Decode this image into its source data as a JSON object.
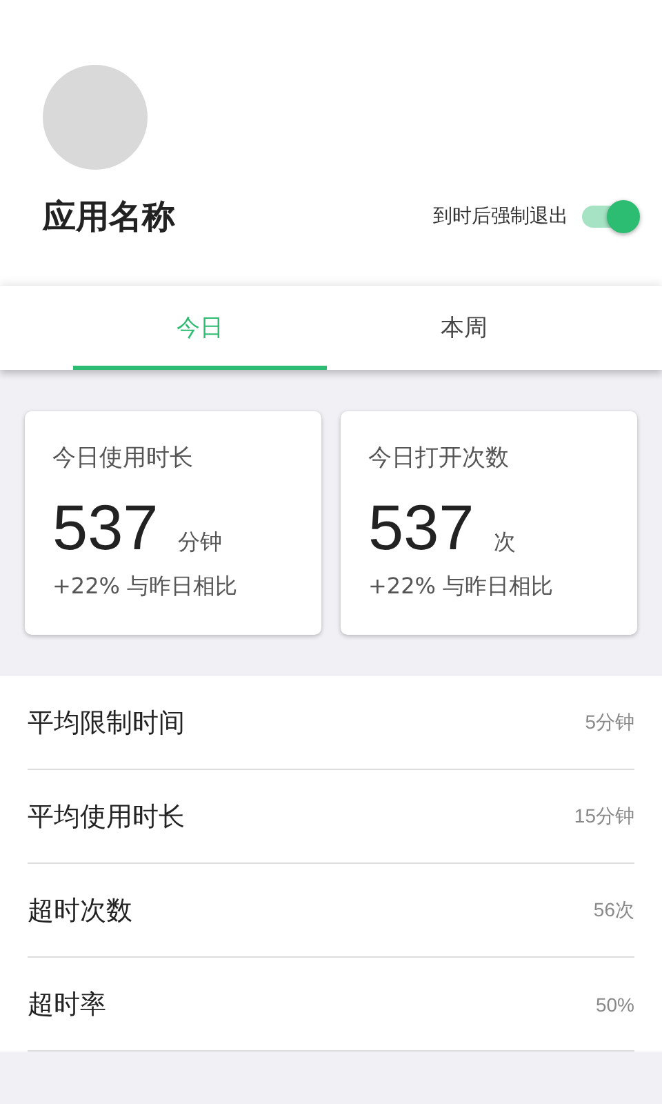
{
  "app": {
    "name": "应用名称"
  },
  "force_quit": {
    "label": "到时后强制退出",
    "on": true
  },
  "tabs": [
    {
      "label": "今日",
      "selected": true
    },
    {
      "label": "本周",
      "selected": false
    }
  ],
  "cards": [
    {
      "title": "今日使用时长",
      "value": "537",
      "unit": "分钟",
      "comparison": "+22% 与昨日相比"
    },
    {
      "title": "今日打开次数",
      "value": "537",
      "unit": "次",
      "comparison": "+22% 与昨日相比"
    }
  ],
  "stats": [
    {
      "label": "平均限制时间",
      "value": "5分钟"
    },
    {
      "label": "平均使用时长",
      "value": "15分钟"
    },
    {
      "label": "超时次数",
      "value": "56次"
    },
    {
      "label": "超时率",
      "value": "50%"
    }
  ]
}
